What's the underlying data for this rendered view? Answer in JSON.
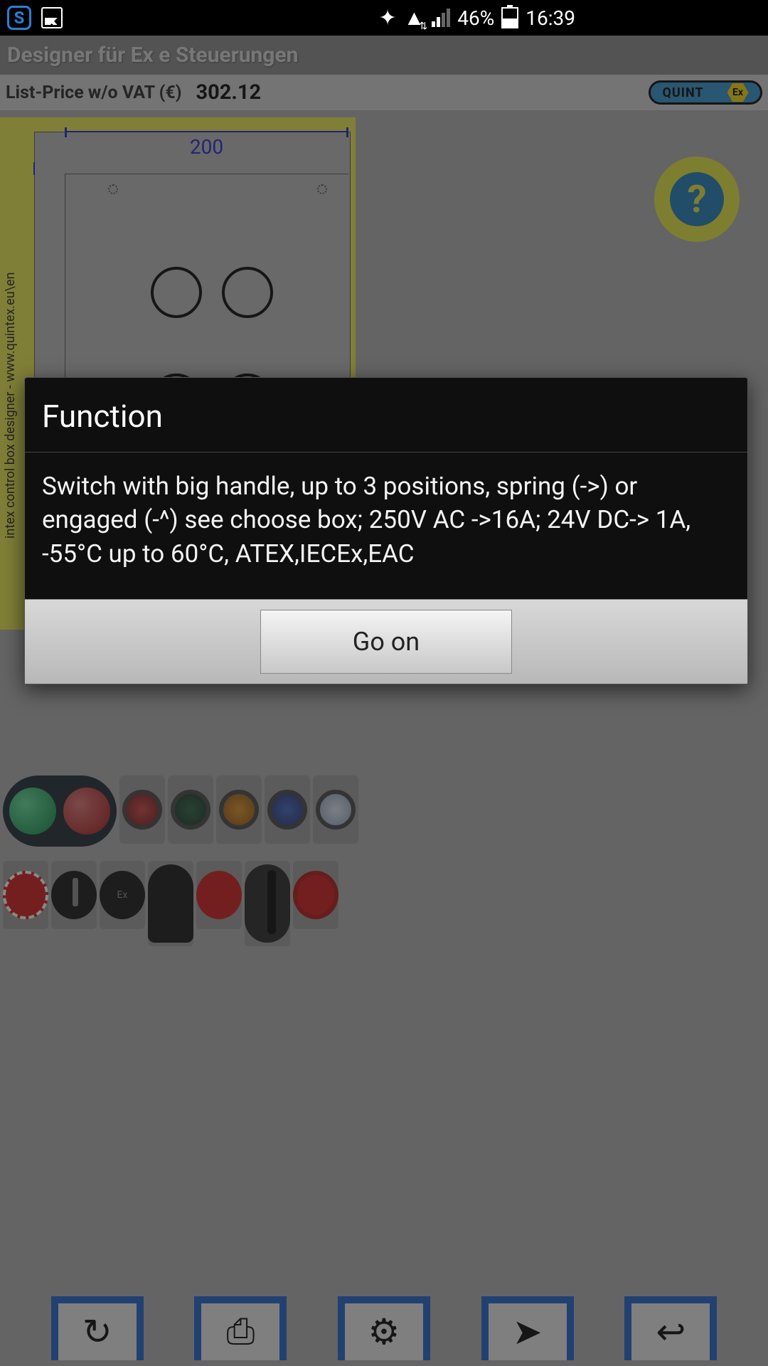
{
  "status_bar": {
    "battery_percent": "46%",
    "time": "16:39"
  },
  "app": {
    "title": "Designer für Ex e Steuerungen",
    "price_label": "List-Price w/o VAT (€)",
    "price_value": "302.12",
    "brand": "QUINT",
    "brand_ex": "Ex",
    "help_glyph": "?",
    "sidebar_text": "intex control box designer -  www.quintex.eu\\en",
    "dimension_top": "200"
  },
  "toolbar": {
    "rotate": "↻",
    "screenshot": "⎙",
    "fitting": "⚙",
    "send": "➤",
    "back": "↩"
  },
  "dialog": {
    "title": "Function",
    "body": "Switch with big handle, up to 3 positions, spring (->) or engaged (-^) see choose box; 250V AC ->16A; 24V DC-> 1A, -55°C up to 60°C, ATEX,IECEx,EAC",
    "confirm_label": "Go on"
  }
}
